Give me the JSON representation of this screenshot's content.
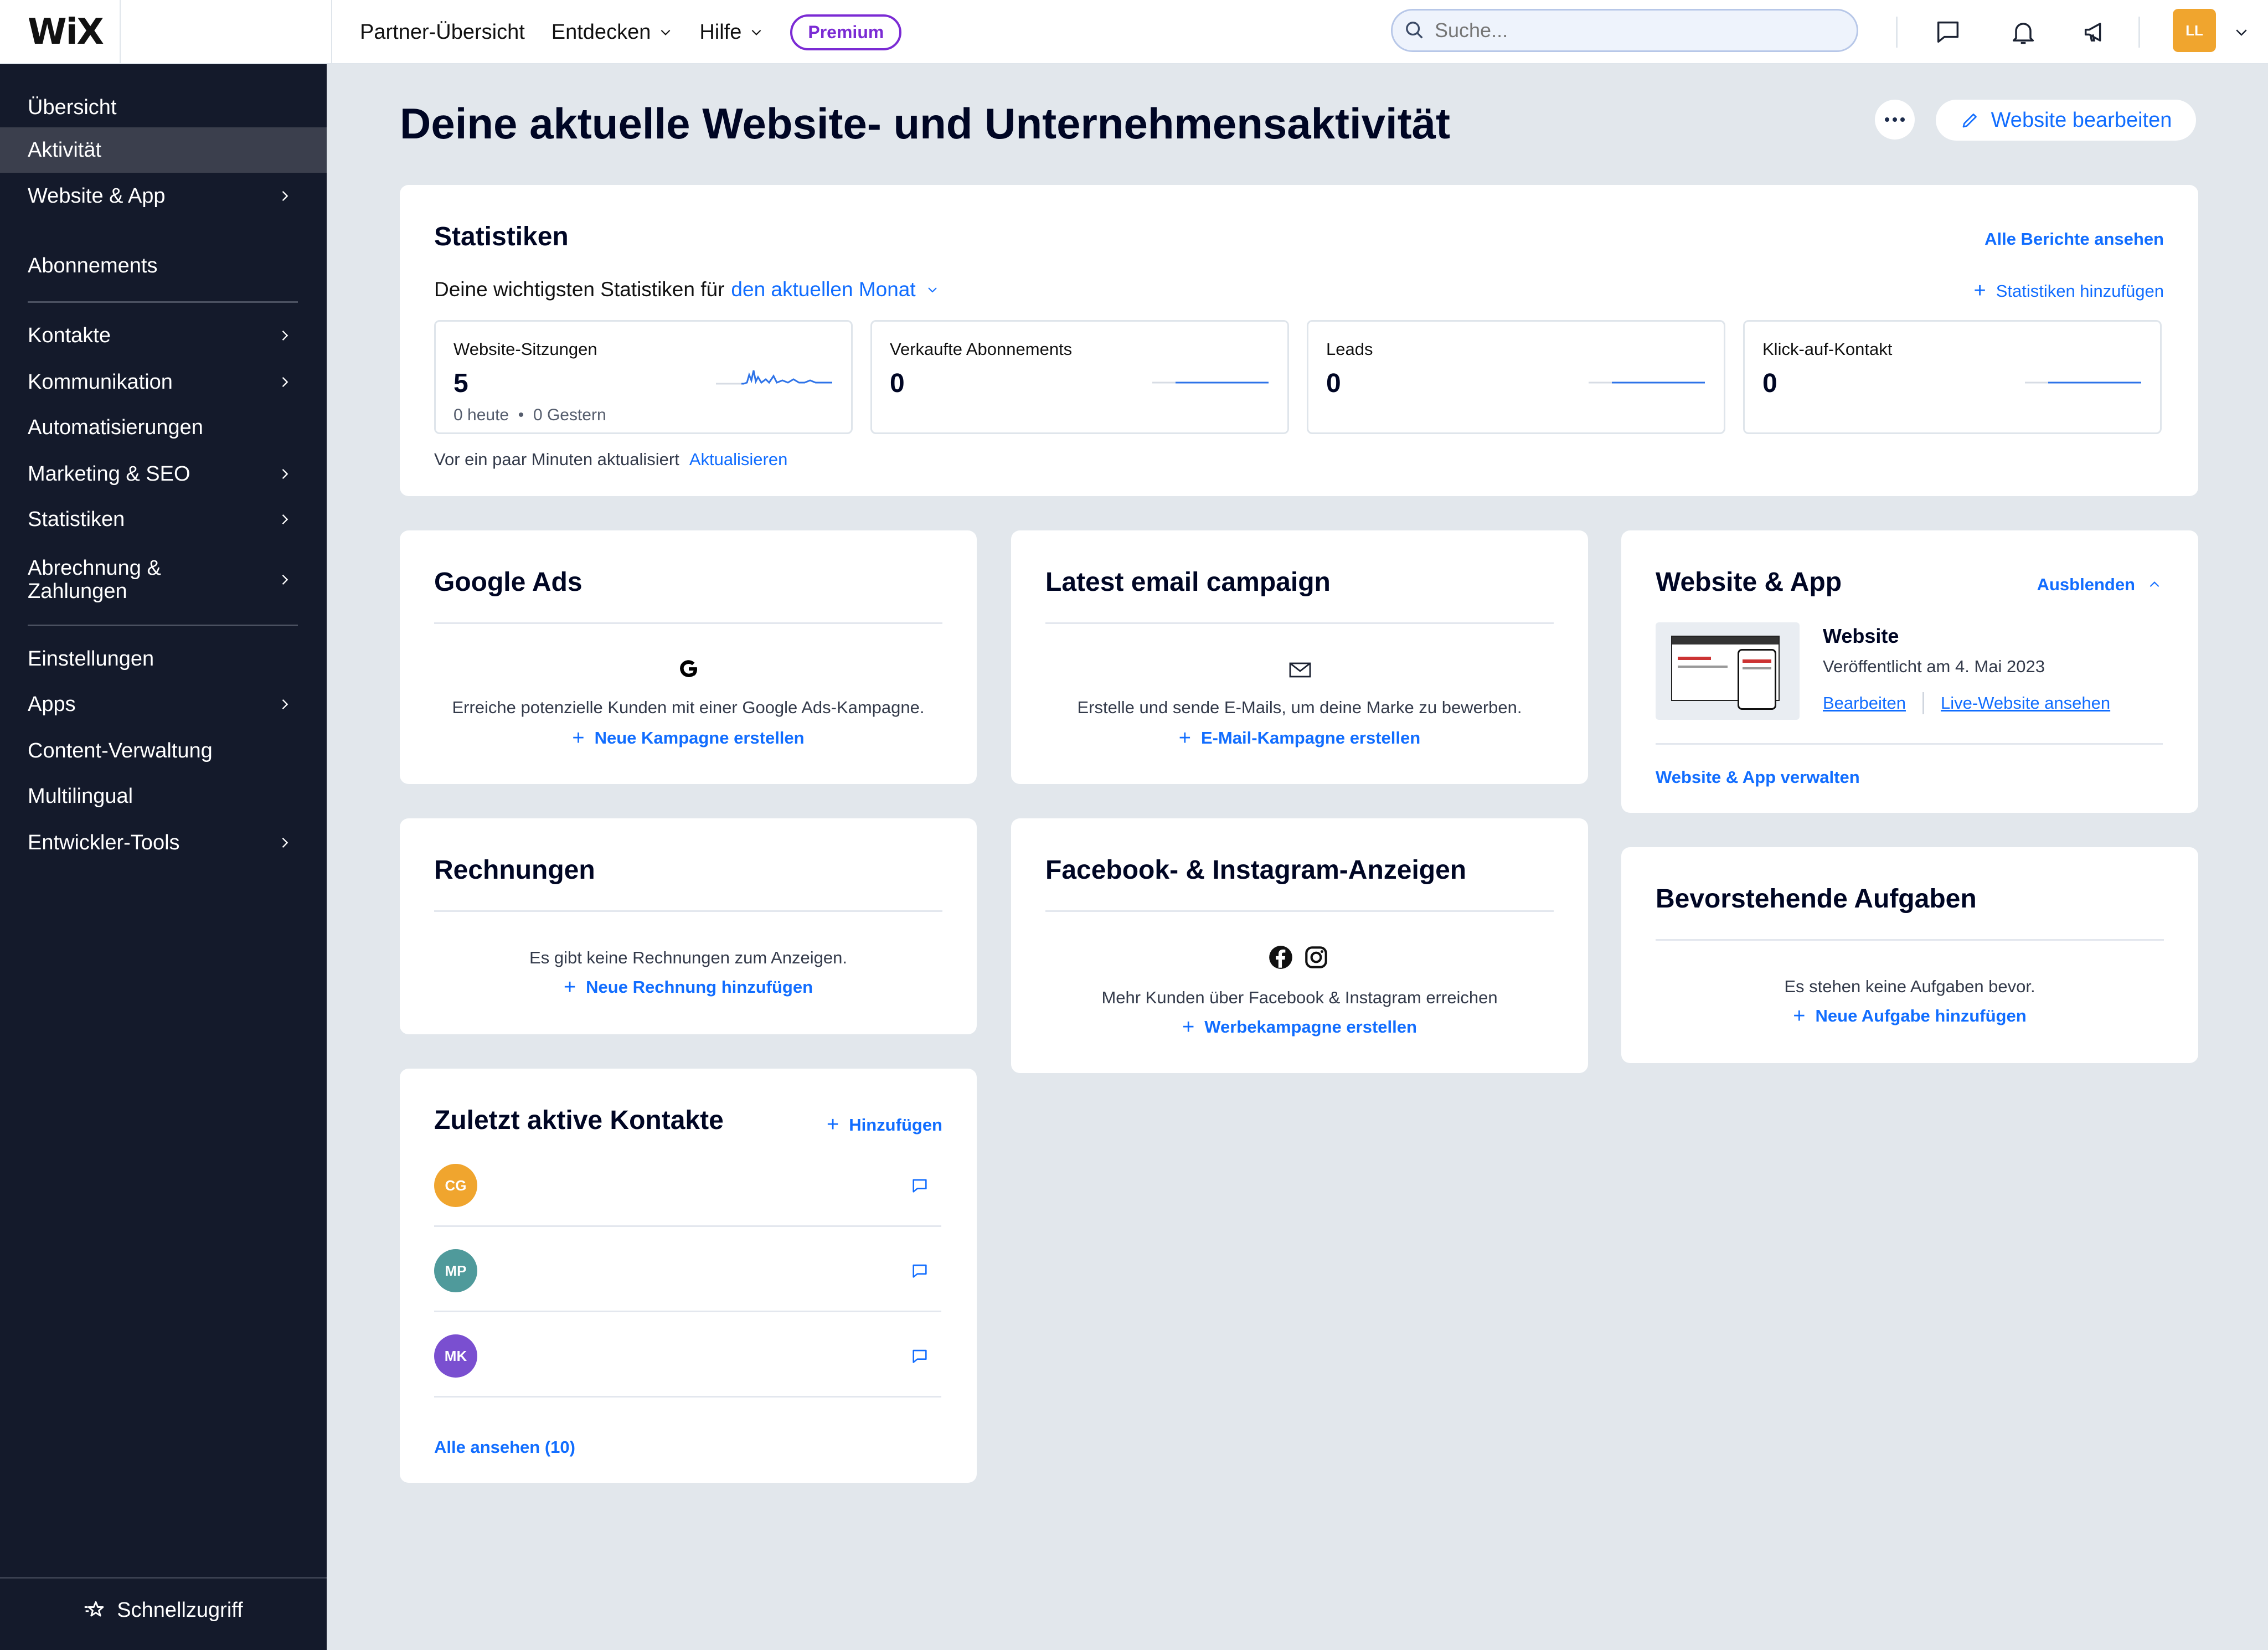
{
  "brand": "WiX",
  "topnav": {
    "partner": "Partner-Übersicht",
    "entdecken": "Entdecken",
    "hilfe": "Hilfe",
    "premium": "Premium",
    "search_placeholder": "Suche...",
    "avatar_initials": "LL"
  },
  "sidebar": {
    "items": [
      {
        "label": "Übersicht"
      },
      {
        "label": "Aktivität"
      },
      {
        "label": "Website & App"
      },
      {
        "label": "Abonnements"
      },
      {
        "label": "Kontakte"
      },
      {
        "label": "Kommunikation"
      },
      {
        "label": "Automatisierungen"
      },
      {
        "label": "Marketing & SEO"
      },
      {
        "label": "Statistiken"
      },
      {
        "label": "Abrechnung & Zahlungen"
      },
      {
        "label": "Einstellungen"
      },
      {
        "label": "Apps"
      },
      {
        "label": "Content-Verwaltung"
      },
      {
        "label": "Multilingual"
      },
      {
        "label": "Entwickler-Tools"
      }
    ],
    "quick_access": "Schnellzugriff"
  },
  "main": {
    "title": "Deine aktuelle Website- und Unternehmensaktivität",
    "edit_button": "Website bearbeiten"
  },
  "stats": {
    "title": "Statistiken",
    "all_reports": "Alle Berichte ansehen",
    "subtitle_prefix": "Deine wichtigsten Statistiken für",
    "period": "den aktuellen Monat",
    "add_stats": "Statistiken hinzufügen",
    "boxes": [
      {
        "label": "Website-Sitzungen",
        "value": "5",
        "today": "0 heute",
        "yesterday": "0 Gestern"
      },
      {
        "label": "Verkaufte Abonnements",
        "value": "0"
      },
      {
        "label": "Leads",
        "value": "0"
      },
      {
        "label": "Klick-auf-Kontakt",
        "value": "0"
      }
    ],
    "updated": "Vor ein paar Minuten aktualisiert",
    "refresh": "Aktualisieren"
  },
  "google_ads": {
    "title": "Google Ads",
    "text": "Erreiche potenzielle Kunden mit einer Google Ads-Kampagne.",
    "link": "Neue Kampagne erstellen"
  },
  "email": {
    "title": "Latest email campaign",
    "text": "Erstelle und sende E-Mails, um deine Marke zu bewerben.",
    "link": "E-Mail-Kampagne erstellen"
  },
  "website_app": {
    "title": "Website & App",
    "hide": "Ausblenden",
    "site_name": "Website",
    "published": "Veröffentlicht am 4. Mai 2023",
    "edit": "Bearbeiten",
    "view_live": "Live-Website ansehen",
    "manage": "Website & App verwalten"
  },
  "invoices": {
    "title": "Rechnungen",
    "text": "Es gibt keine Rechnungen zum Anzeigen.",
    "link": "Neue Rechnung hinzufügen"
  },
  "fb_ig": {
    "title": "Facebook- & Instagram-Anzeigen",
    "text": "Mehr Kunden über Facebook & Instagram erreichen",
    "link": "Werbekampagne erstellen"
  },
  "tasks": {
    "title": "Bevorstehende Aufgaben",
    "text": "Es stehen keine Aufgaben bevor.",
    "link": "Neue Aufgabe hinzufügen"
  },
  "contacts": {
    "title": "Zuletzt aktive Kontakte",
    "add": "Hinzufügen",
    "items": [
      {
        "initials": "CG",
        "color": "#f0a52e"
      },
      {
        "initials": "MP",
        "color": "#4f9a9b"
      },
      {
        "initials": "MK",
        "color": "#7a4fd0"
      }
    ],
    "view_all": "Alle ansehen (10)"
  },
  "colors": {
    "accent": "#116dff",
    "sidebar_bg": "#141a2b",
    "premium": "#7b2bd4"
  }
}
